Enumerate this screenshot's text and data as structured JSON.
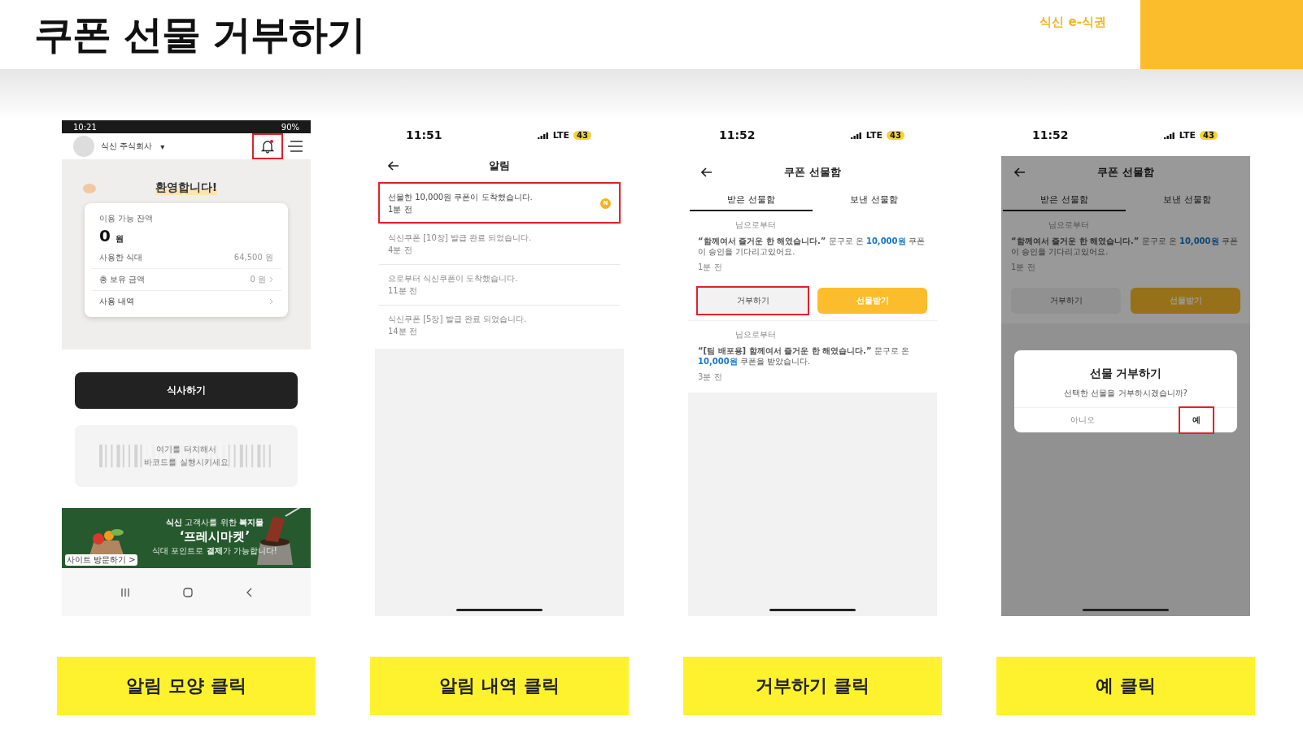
{
  "header": {
    "title": "쿠폰 선물 거부하기",
    "logo": "식신 e-식권"
  },
  "steps": [
    {
      "kind": "home",
      "caption": "알림 모양 클릭",
      "screen": {
        "status": {
          "time": "10:21",
          "battery": "90%"
        },
        "company": "식신 주식회사",
        "dropdown_mark": "▾",
        "bell_highlighted": true,
        "welcome": "환영합니다!",
        "balance_label": "이용 가능 잔액",
        "balance": "0",
        "balance_unit": "원",
        "rows": [
          {
            "label": "사용한 식대",
            "value": "64,500",
            "unit": "원",
            "arrow": false
          },
          {
            "label": "총 보유 금액",
            "value": "0",
            "unit": "원",
            "arrow": true
          },
          {
            "label": "사용 내역",
            "arrow": true
          }
        ],
        "meal_button": "식사하기",
        "barcode_lines": [
          "여기를 터치해서",
          "바코드를 실행시키세요"
        ],
        "banner": {
          "headline": "**식신** 고객사를 위한 **복지몰**",
          "title": "‘프레시마켓’",
          "subline": "식대 포인트로 **결제**가 가능합니다!",
          "link": "사이트 방문하기 >"
        }
      }
    },
    {
      "kind": "notifications",
      "caption": "알림 내역 클릭",
      "screen": {
        "status": {
          "time": "11:51",
          "network": "LTE",
          "battery": "43"
        },
        "title": "알림",
        "items": [
          {
            "text": "선물한 10,000원 쿠폰이 도착했습니다.",
            "time": "1분 전",
            "badge": "N",
            "highlighted": true
          },
          {
            "text": "식신쿠폰 [10장] 발급 완료 되었습니다.",
            "time": "4분 전",
            "highlighted": false
          },
          {
            "text": "으로부터 식신쿠폰이 도착했습니다.",
            "time": "11분 전",
            "highlighted": false
          },
          {
            "text": "식신쿠폰 [5장] 발급 완료 되었습니다.",
            "time": "14분 전",
            "highlighted": false
          }
        ]
      }
    },
    {
      "kind": "giftbox",
      "caption": "거부하기 클릭",
      "screen": {
        "status": {
          "time": "11:52",
          "network": "LTE",
          "battery": "43"
        },
        "title": "쿠폰 선물함",
        "tabs": [
          {
            "label": "받은 선물함",
            "selected": true
          },
          {
            "label": "보낸 선물함",
            "selected": false
          }
        ],
        "gifts": [
          {
            "from": "님으로부터",
            "message": "**“함께여서 즐거운 한 해였습니다.”** 문구로 온 *10,000원* 쿠폰이 승인을 기다리고있어요.",
            "time": "1분 전",
            "actions": [
              {
                "label": "거부하기",
                "kind": "secondary",
                "highlighted": true
              },
              {
                "label": "선물받기",
                "kind": "primary",
                "highlighted": false
              }
            ]
          },
          {
            "from": "님으로부터",
            "message": "**“[팀 배포용] 함께여서 즐거운 한 해였습니다.”** 문구로 온 *10,000원* 쿠폰을 받았습니다.",
            "time": "3분 전"
          }
        ]
      }
    },
    {
      "kind": "giftbox",
      "caption": "예 클릭",
      "screen": {
        "status": {
          "time": "11:52",
          "network": "LTE",
          "battery": "43"
        },
        "title": "쿠폰 선물함",
        "tabs": [
          {
            "label": "받은 선물함",
            "selected": true
          },
          {
            "label": "보낸 선물함",
            "selected": false
          }
        ],
        "gifts": [
          {
            "from": "님으로부터",
            "message": "**“함께여서 즐거운 한 해였습니다.”** 문구로 온 *10,000원* 쿠폰이 승인을 기다리고있어요.",
            "time": "1분 전",
            "actions": [
              {
                "label": "거부하기",
                "kind": "secondary",
                "highlighted": false
              },
              {
                "label": "선물받기",
                "kind": "primary",
                "highlighted": false
              }
            ]
          }
        ],
        "dialog": {
          "title": "선물 거부하기",
          "message": "선택한 선물을 거부하시겠습니까?",
          "buttons": [
            {
              "label": "아니오",
              "kind": "cancel",
              "highlighted": false
            },
            {
              "label": "예",
              "kind": "confirm",
              "highlighted": true
            }
          ]
        }
      }
    }
  ]
}
